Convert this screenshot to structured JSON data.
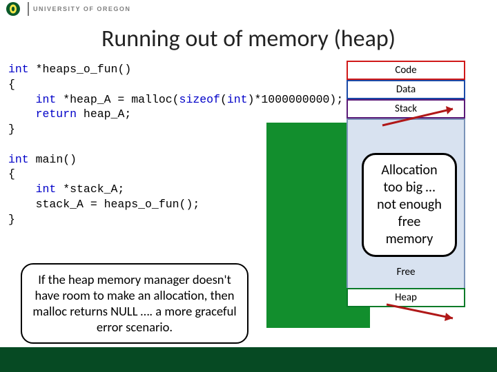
{
  "header": {
    "university": "UNIVERSITY OF OREGON",
    "logo_letter": "O"
  },
  "title": "Running out of memory (heap)",
  "code": {
    "l1a": "int",
    "l1b": " *heaps_o_fun()",
    "l2": "{",
    "l3a": "    int",
    "l3b": " *heap_A = malloc(",
    "l3c": "sizeof",
    "l3d": "(",
    "l3e": "int",
    "l3f": ")*1000000000);",
    "l4a": "    return",
    "l4b": " heap_A;",
    "l5": "}",
    "l6": "",
    "l7a": "int",
    "l7b": " main()",
    "l8": "{",
    "l9a": "    int",
    "l9b": " *stack_A;",
    "l10": "    stack_A = heaps_o_fun();",
    "l11": "}"
  },
  "memory": {
    "code": "Code",
    "data": "Data",
    "stack": "Stack",
    "free": "Free",
    "heap": "Heap"
  },
  "callouts": {
    "allocation": "Allocation too big … not enough free memory",
    "note": "If the heap memory manager doesn't have room to make an allocation, then malloc returns NULL …. a more graceful error scenario."
  },
  "colors": {
    "green": "#128e2d",
    "footer": "#064a23",
    "code_border": "#d01818",
    "data_border": "#1a4aa8",
    "stack_border": "#5a1a78",
    "heap_border": "#0a7a28"
  }
}
